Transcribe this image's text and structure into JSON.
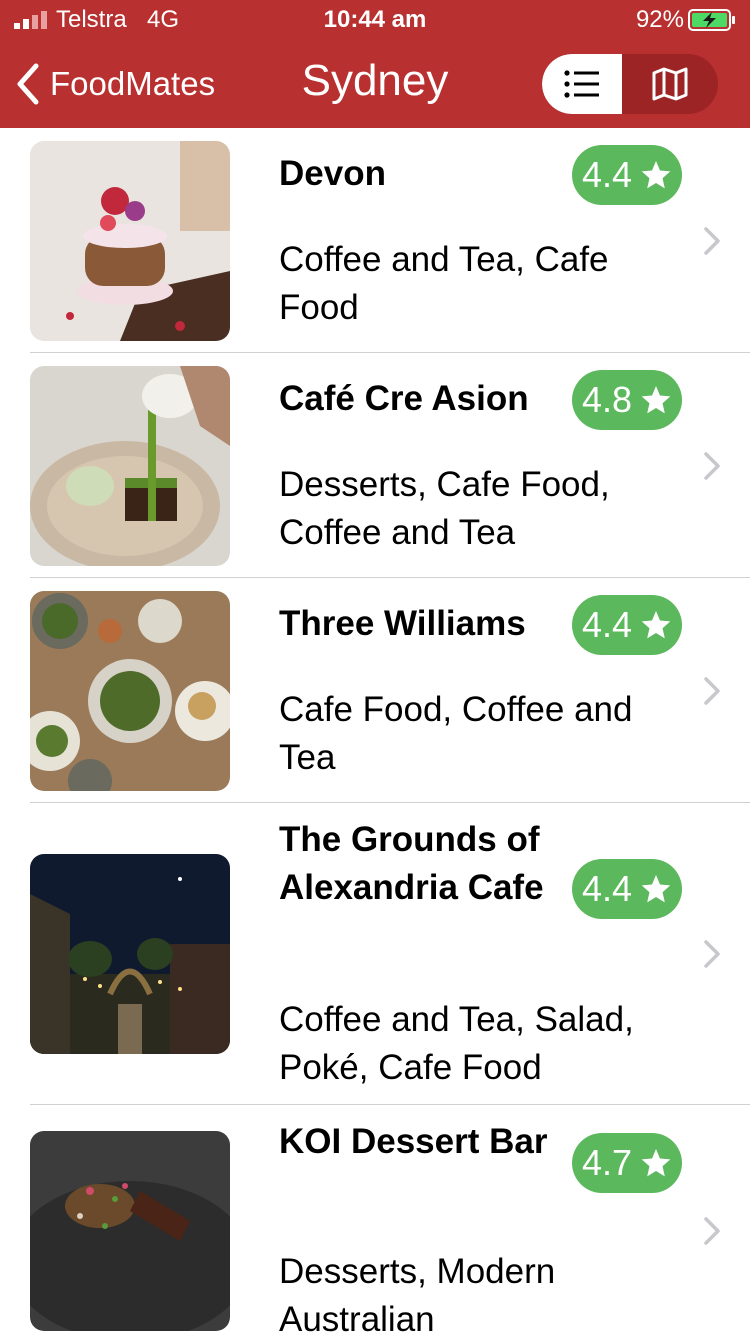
{
  "status_bar": {
    "carrier": "Telstra",
    "network": "4G",
    "time": "10:44 am",
    "battery_percent": "92%",
    "signal_icon": "signal-bars-icon",
    "battery_icon": "battery-charging-icon"
  },
  "nav": {
    "back_label": "FoodMates",
    "title": "Sydney",
    "view_toggle": {
      "selected": "list",
      "options": [
        "list",
        "map"
      ]
    }
  },
  "colors": {
    "header_bg": "#b8302f",
    "segment_bg": "#9d2424",
    "rating_badge": "#5cb85c",
    "divider": "#d0d0d0"
  },
  "restaurants": [
    {
      "name": "Devon",
      "rating": "4.4",
      "categories": "Coffee and Tea, Cafe Food",
      "image": "layered dessert with flowers"
    },
    {
      "name": "Café Cre Asion",
      "rating": "4.8",
      "categories": "Desserts, Cafe Food, Coffee and Tea",
      "image": "matcha poured over dessert"
    },
    {
      "name": "Three Williams",
      "rating": "4.4",
      "categories": "Cafe Food, Coffee and Tea",
      "image": "table of brunch dishes"
    },
    {
      "name": "The Grounds of Alexandria Cafe",
      "rating": "4.4",
      "categories": "Coffee and Tea, Salad, Poké, Cafe Food",
      "image": "garden courtyard at night"
    },
    {
      "name": "KOI Dessert Bar",
      "rating": "4.7",
      "categories": "Desserts, Modern Australian",
      "image": "chocolate dessert on dark plate"
    }
  ]
}
